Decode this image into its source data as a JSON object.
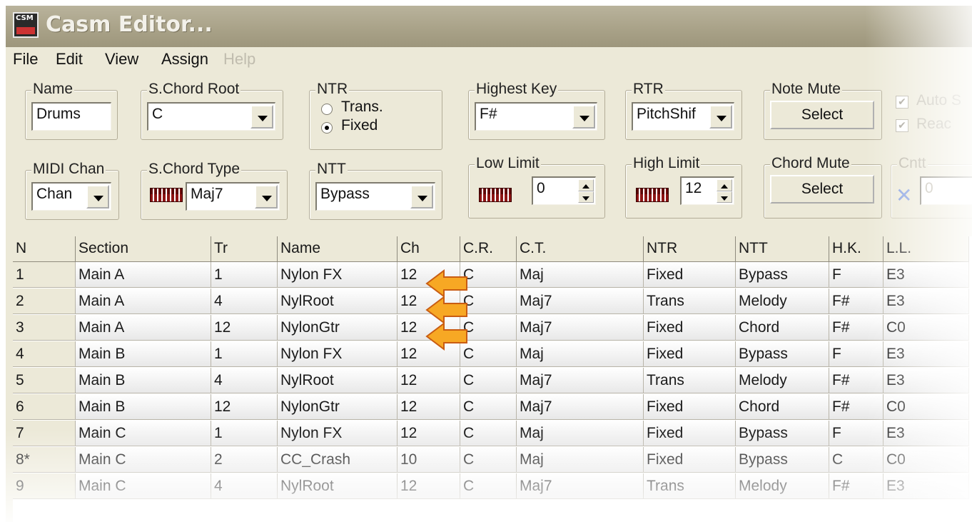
{
  "window": {
    "title": "Casm Editor..."
  },
  "app_icon": {
    "text": "CSM",
    "icon": "casm-app-icon"
  },
  "menu": [
    "File",
    "Edit",
    "View",
    "Assign",
    "Help"
  ],
  "controls": {
    "name": {
      "label": "Name",
      "value": "Drums"
    },
    "s_chord_root": {
      "label": "S.Chord Root",
      "value": "C"
    },
    "ntr": {
      "label": "NTR",
      "options": [
        "Trans.",
        "Fixed"
      ],
      "selected": "Fixed"
    },
    "highest_key": {
      "label": "Highest Key",
      "value": "F#"
    },
    "rtr": {
      "label": "RTR",
      "value": "PitchShif"
    },
    "note_mute": {
      "label": "Note Mute",
      "button": "Select"
    },
    "auto": {
      "label": "Auto S",
      "checked": true
    },
    "reac": {
      "label": "Reac",
      "checked": true
    },
    "midi_chan": {
      "label": "MIDI Chan",
      "value": "Chan"
    },
    "s_chord_type": {
      "label": "S.Chord Type",
      "value": "Maj7"
    },
    "ntt": {
      "label": "NTT",
      "value": "Bypass"
    },
    "low_limit": {
      "label": "Low Limit",
      "value": "0"
    },
    "high_limit": {
      "label": "High Limit",
      "value": "12"
    },
    "chord_mute": {
      "label": "Chord Mute",
      "button": "Select"
    },
    "cntt": {
      "label": "Cntt",
      "value": "0"
    }
  },
  "table": {
    "columns": [
      "N",
      "Section",
      "Tr",
      "Name",
      "Ch",
      "C.R.",
      "C.T.",
      "NTR",
      "NTT",
      "H.K.",
      "L.L."
    ],
    "rows": [
      [
        "1",
        "Main A",
        "1",
        "Nylon FX",
        "12",
        "C",
        "Maj",
        "Fixed",
        "Bypass",
        "F",
        "E3"
      ],
      [
        "2",
        "Main A",
        "4",
        "NylRoot",
        "12",
        "C",
        "Maj7",
        "Trans",
        "Melody",
        "F#",
        "E3"
      ],
      [
        "3",
        "Main A",
        "12",
        "NylonGtr",
        "12",
        "C",
        "Maj7",
        "Fixed",
        "Chord",
        "F#",
        "C0"
      ],
      [
        "4",
        "Main B",
        "1",
        "Nylon FX",
        "12",
        "C",
        "Maj",
        "Fixed",
        "Bypass",
        "F",
        "E3"
      ],
      [
        "5",
        "Main B",
        "4",
        "NylRoot",
        "12",
        "C",
        "Maj7",
        "Trans",
        "Melody",
        "F#",
        "E3"
      ],
      [
        "6",
        "Main B",
        "12",
        "NylonGtr",
        "12",
        "C",
        "Maj7",
        "Fixed",
        "Chord",
        "F#",
        "C0"
      ],
      [
        "7",
        "Main C",
        "1",
        "Nylon FX",
        "12",
        "C",
        "Maj",
        "Fixed",
        "Bypass",
        "F",
        "E3"
      ],
      [
        "8*",
        "Main C",
        "2",
        "CC_Crash",
        "10",
        "C",
        "Maj",
        "Fixed",
        "Bypass",
        "C",
        "C0"
      ],
      [
        "9",
        "Main C",
        "4",
        "NylRoot",
        "12",
        "C",
        "Maj7",
        "Trans",
        "Melody",
        "F#",
        "E3"
      ]
    ]
  },
  "annotations": {
    "arrow_color": "#f7a824",
    "arrow_rows": [
      "1",
      "2",
      "3"
    ]
  }
}
